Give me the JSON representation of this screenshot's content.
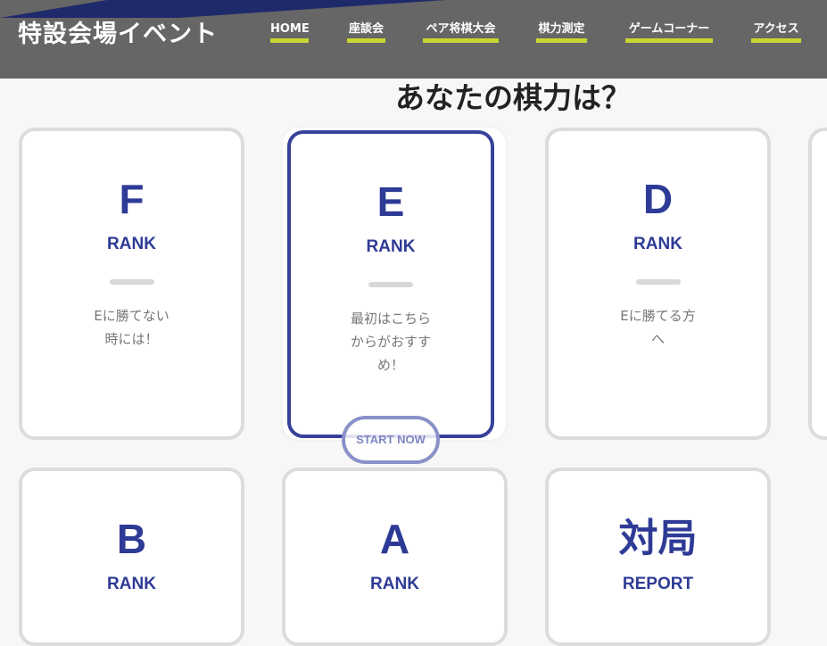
{
  "header": {
    "title": "特設会場イベント",
    "nav": [
      "HOME",
      "座談会",
      "ペア将棋大会",
      "棋力測定",
      "ゲームコーナー",
      "アクセス"
    ]
  },
  "section": {
    "title": "あなたの棋力は？"
  },
  "cards": [
    {
      "letter": "F",
      "word": "RANK",
      "desc": "Eに勝てない\n時には！"
    },
    {
      "letter": "E",
      "word": "RANK",
      "desc": "最初はこちら\nからがおすす\nめ！"
    },
    {
      "letter": "D",
      "word": "RANK",
      "desc": "Eに勝てる方\nへ"
    },
    {
      "letter": "B",
      "word": "RANK",
      "desc": ""
    },
    {
      "letter": "A",
      "word": "RANK",
      "desc": ""
    },
    {
      "letter": "対局",
      "word": "REPORT",
      "desc": ""
    }
  ],
  "start_button": "START NOW",
  "colors": {
    "header_bg": "#666666",
    "nav_underline": "#c9d632",
    "accent": "#2e3b96",
    "active_border": "#38419a"
  }
}
